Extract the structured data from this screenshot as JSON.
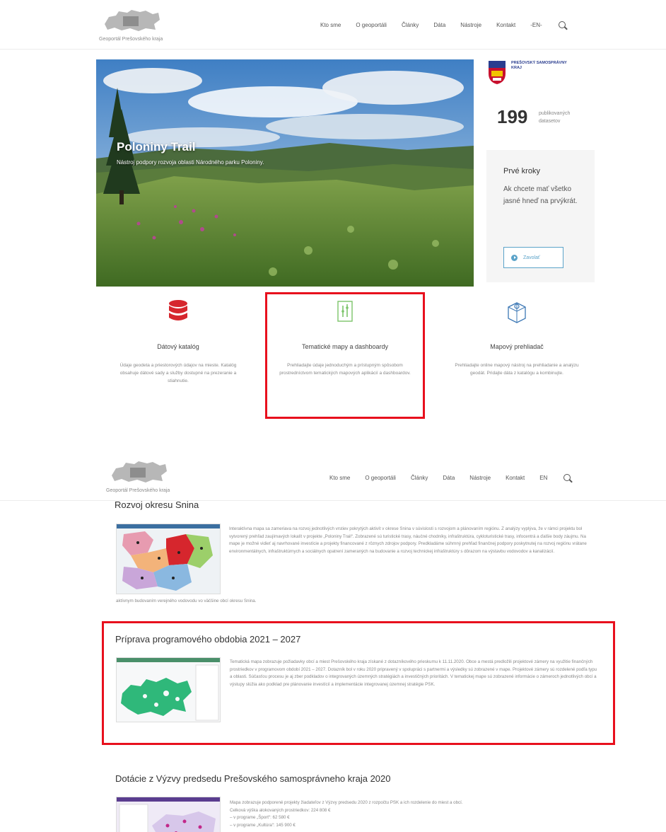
{
  "header": {
    "logo_caption": "Geoportál Prešovského kraja",
    "nav": [
      "Kto sme",
      "O geoportáli",
      "Články",
      "Dáta",
      "Nástroje",
      "Kontakt",
      "-EN-"
    ],
    "nav_lower": [
      "Kto sme",
      "O geoportáli",
      "Články",
      "Dáta",
      "Nástroje",
      "Kontakt",
      "EN"
    ]
  },
  "hero": {
    "title": "Poloniny Trail",
    "subtitle": "Nástroj podpory rozvoja oblasti Národného parku Poloniny."
  },
  "sidebar": {
    "region_name": "PREŠOVSKÝ SAMOSPRÁVNY KRAJ",
    "stats_number": "199",
    "stats_label": "publikovaných datasetov",
    "first_steps_title": "Prvé kroky",
    "first_steps_text": "Ak chcete mať všetko jasné hneď na prvýkrát.",
    "first_steps_button": "Zavolať"
  },
  "features": [
    {
      "title": "Dátový katalóg",
      "desc": "Údaje geodeta a priestorových údajov na mieste. Katalóg obsahuje dátové sady a služby dostupné na prezeranie a stiahnutie."
    },
    {
      "title": "Tematické mapy a dashboardy",
      "desc": "Prehliadajte údaje jednoduchým a prístupným spôsobom prostredníctvom tematických mapových aplikácií a dashboardov."
    },
    {
      "title": "Mapový prehliadač",
      "desc": "Prehliadajte online mapový nástroj na prehliadanie a analýzu geodát. Pridajte dáta z katalógu a kombinujte."
    }
  ],
  "articles": [
    {
      "title": "Rozvoj okresu Snina",
      "body": "Interaktívna mapa sa zameriava na rozvoj jednotlivých vrstiev pokrytých aktivít v okrese Snina v súvislosti s rozvojom a plánovaním regiónu. Z analýzy vyplýva, že v rámci projektu bol vytvorený prehľad zaujímavých lokalít v projekte „Poloniny Trail“. Zobrazené sú turistické trasy, náučné chodníky, infraštruktúra, cykloturistické trasy, infocentrá a ďalšie body záujmu. Na mape je možné vidieť aj navrhované investície a projekty financované z rôznych zdrojov podpory. Predkladáme súhrnný prehľad finančnej podpory poskytnutej na rozvoj regiónu vrátane environmentálnych, infraštruktúrnych a sociálnych opatrení zameraných na budovanie a rozvoj technickej infraštruktúry s dôrazom na výstavbu vodovodov a kanalizácií.",
      "tail": "aktívnym budovaním verejného vodovodu vo väčšine obcí okresu Snina."
    },
    {
      "title": "Príprava programového obdobia 2021 – 2027",
      "body": "Tematická mapa zobrazuje požiadavky obcí a miest Prešovského kraja získané z dotazníkového prieskumu k 11.11.2020. Obce a mestá predložili projektové zámery na využitie finančných prostriedkov v programovom období 2021 – 2027. Dotazník bol v roku 2020 pripravený v spolupráci s partnermi a výsledky sú zobrazené v mape. Projektové zámery sú rozdelené podľa typu a oblasti. Súčasťou procesu je aj zber podkladov o integrovaných územných stratégiách a investičných prioritách. V tematickej mape sú zobrazené informácie o zámeroch jednotlivých obcí a výstupy slúžia ako podklad pre plánovanie investícií a implementácie integrovanej územnej stratégie PSK."
    },
    {
      "title": "Dotácie z Výzvy predsedu Prešovského samosprávneho kraja 2020",
      "body": "Mapa zobrazuje podporené projekty žiadateľov z Výzvy predsedu 2020 z rozpočtu PSK a ich rozdelenie do miest a obcí.",
      "lines": [
        "Celková výška alokovaných prostriedkov: 224 808 €",
        "– v programe „Šport“: 62 580 €",
        "– v programe „Kultúra“: 145 900 €"
      ]
    }
  ]
}
